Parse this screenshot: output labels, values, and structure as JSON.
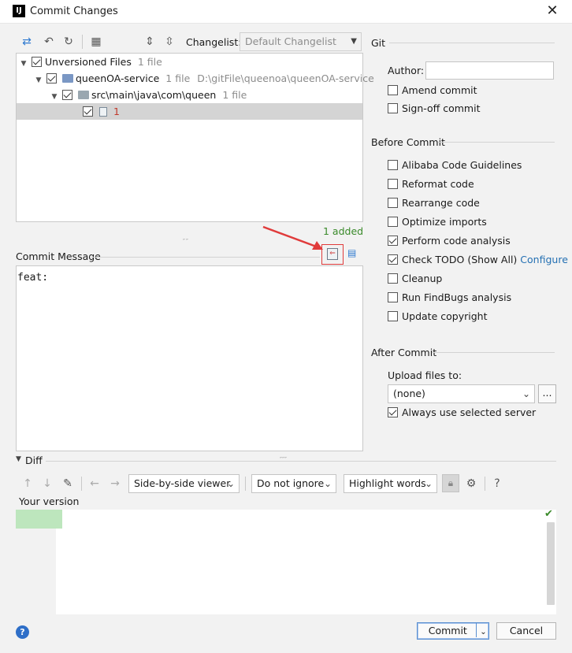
{
  "window": {
    "title": "Commit Changes",
    "app_icon": "intellij-icon"
  },
  "toolbar": {
    "changelist_label": "Changelist:",
    "changelist_value": "Default Changelist"
  },
  "tree": {
    "rows": [
      {
        "label": "Unversioned Files",
        "meta": "1 file",
        "checked": true
      },
      {
        "label": "queenOA-service",
        "meta": "1 file",
        "path": "D:\\gitFile\\queenoa\\queenOA-service",
        "checked": true
      },
      {
        "label": "src\\main\\java\\com\\queen",
        "meta": "1 file",
        "checked": true
      },
      {
        "label": "1",
        "checked": true,
        "selected": true
      }
    ]
  },
  "status": {
    "added": "1 added"
  },
  "commit_message": {
    "label": "Commit Message",
    "value": "feat:"
  },
  "git": {
    "header": "Git",
    "author_label": "Author:",
    "author_value": "",
    "amend": {
      "label": "Amend commit",
      "checked": false
    },
    "signoff": {
      "label": "Sign-off commit",
      "checked": false
    }
  },
  "before_commit": {
    "header": "Before Commit",
    "options": [
      {
        "label": "Alibaba Code Guidelines",
        "checked": false
      },
      {
        "label": "Reformat code",
        "checked": false
      },
      {
        "label": "Rearrange code",
        "checked": false
      },
      {
        "label": "Optimize imports",
        "checked": false
      },
      {
        "label": "Perform code analysis",
        "checked": true
      },
      {
        "label": "Check TODO (Show All)",
        "checked": true,
        "link": "Configure"
      },
      {
        "label": "Cleanup",
        "checked": false
      },
      {
        "label": "Run FindBugs analysis",
        "checked": false
      },
      {
        "label": "Update copyright",
        "checked": false
      }
    ]
  },
  "after_commit": {
    "header": "After Commit",
    "upload_label": "Upload files to:",
    "upload_value": "(none)",
    "browse_label": "...",
    "always_use": {
      "label": "Always use selected server",
      "checked": true
    }
  },
  "diff": {
    "header": "Diff",
    "viewer": "Side-by-side viewer",
    "ignore": "Do not ignore",
    "highlight": "Highlight words",
    "help": "?",
    "your_version": "Your version"
  },
  "buttons": {
    "commit": "Commit",
    "cancel": "Cancel",
    "help": "?"
  },
  "colors": {
    "accent": "#2470b3",
    "added": "#3a8a2a",
    "annotation": "#e03b3b",
    "added_bg": "#bde6bd"
  }
}
